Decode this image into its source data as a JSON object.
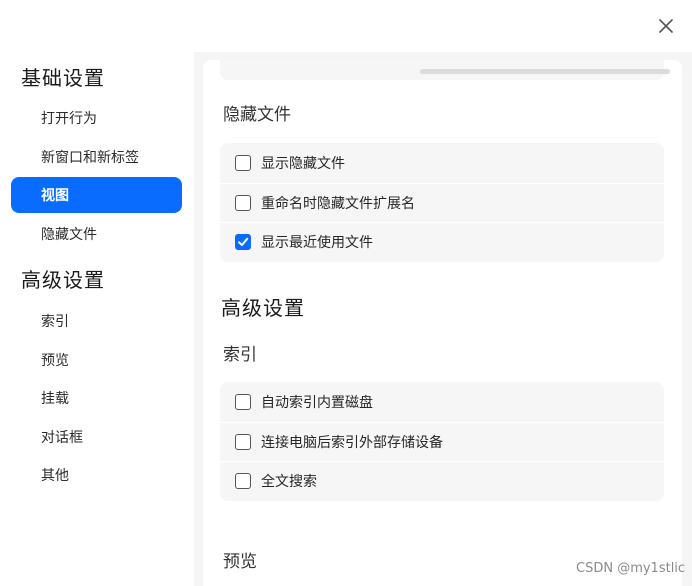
{
  "window": {
    "close_icon": "close-icon"
  },
  "sidebar": {
    "sections": [
      {
        "title": "基础设置",
        "items": [
          {
            "label": "打开行为",
            "active": false
          },
          {
            "label": "新窗口和新标签",
            "active": false
          },
          {
            "label": "视图",
            "active": true
          },
          {
            "label": "隐藏文件",
            "active": false
          }
        ]
      },
      {
        "title": "高级设置",
        "items": [
          {
            "label": "索引",
            "active": false
          },
          {
            "label": "预览",
            "active": false
          },
          {
            "label": "挂载",
            "active": false
          },
          {
            "label": "对话框",
            "active": false
          },
          {
            "label": "其他",
            "active": false
          }
        ]
      }
    ]
  },
  "main": {
    "hidden_files": {
      "title": "隐藏文件",
      "options": [
        {
          "label": "显示隐藏文件",
          "checked": false
        },
        {
          "label": "重命名时隐藏文件扩展名",
          "checked": false
        },
        {
          "label": "显示最近使用文件",
          "checked": true
        }
      ]
    },
    "advanced": {
      "title": "高级设置",
      "index": {
        "title": "索引",
        "options": [
          {
            "label": "自动索引内置磁盘",
            "checked": false
          },
          {
            "label": "连接电脑后索引外部存储设备",
            "checked": false
          },
          {
            "label": "全文搜索",
            "checked": false
          }
        ]
      },
      "preview": {
        "title": "预览"
      }
    }
  },
  "watermark": "CSDN @my1stlic",
  "colors": {
    "accent": "#0a6cff",
    "content_bg": "#f5f5f5",
    "card_bg": "#f6f6f6"
  }
}
